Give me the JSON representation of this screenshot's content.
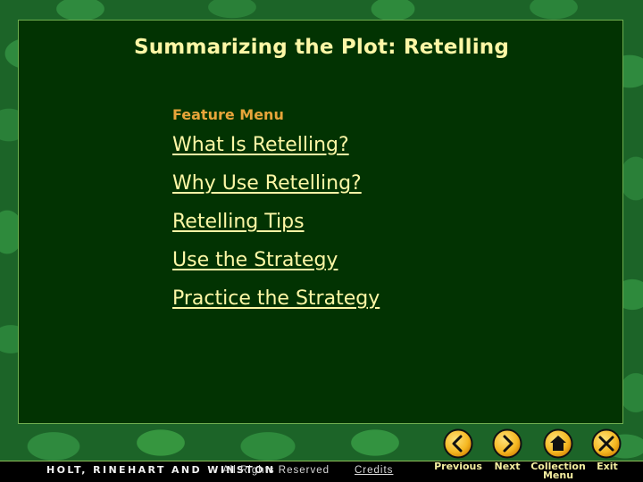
{
  "slide": {
    "title": "Summarizing the Plot: Retelling",
    "feature_menu": {
      "heading": "Feature Menu",
      "items": [
        {
          "label": "What Is Retelling?"
        },
        {
          "label": "Why Use Retelling?"
        },
        {
          "label": "Retelling Tips"
        },
        {
          "label": "Use the Strategy"
        },
        {
          "label": "Practice the Strategy"
        }
      ]
    }
  },
  "footer": {
    "publisher": "HOLT, RINEHART AND WINSTON",
    "rights": "All Rights Reserved",
    "credits_label": "Credits"
  },
  "navigation": {
    "previous": {
      "label": "Previous",
      "icon": "chevron-left-icon"
    },
    "next": {
      "label": "Next",
      "icon": "chevron-right-icon"
    },
    "collection_menu": {
      "label_line1": "Collection",
      "label_line2": "Menu",
      "icon": "home-icon"
    },
    "exit": {
      "label": "Exit",
      "icon": "close-icon"
    }
  },
  "colors": {
    "panel_bg": "#023302",
    "title_text": "#fdf7a6",
    "menu_heading": "#e8a53a",
    "menu_link": "#fdf7a6",
    "button_gold": "#f5b822",
    "footer_bg": "#000000"
  }
}
